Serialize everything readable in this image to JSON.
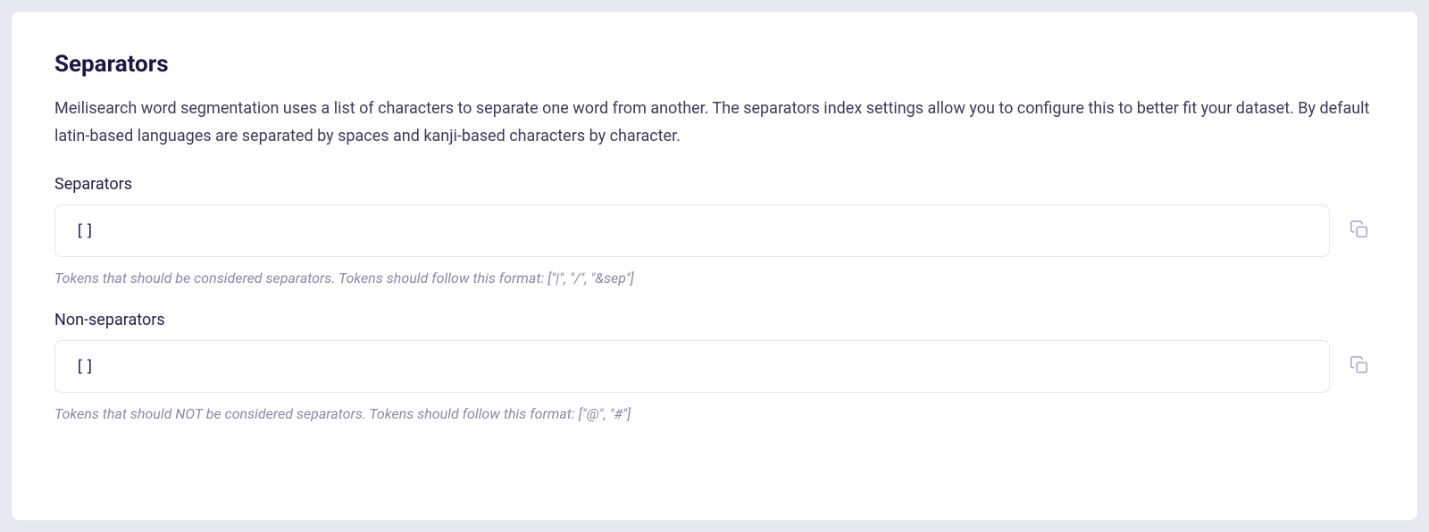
{
  "section": {
    "title": "Separators",
    "description": "Meilisearch word segmentation uses a list of characters to separate one word from another. The separators index settings allow you to configure this to better fit your dataset. By default latin-based languages are separated by spaces and kanji-based characters by character."
  },
  "fields": {
    "separators": {
      "label": "Separators",
      "value": "[]",
      "hint": "Tokens that should be considered separators. Tokens should follow this format: [\"|\", \"/\", \"&sep\"]"
    },
    "nonSeparators": {
      "label": "Non-separators",
      "value": "[]",
      "hint": "Tokens that should NOT be considered separators. Tokens should follow this format: [\"@\", \"#\"]"
    }
  }
}
